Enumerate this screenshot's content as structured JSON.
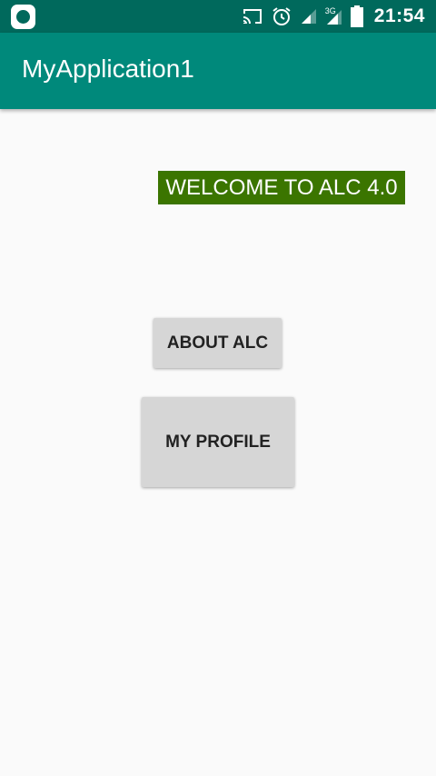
{
  "status_bar": {
    "time": "21:54",
    "network_label": "3G",
    "icons": [
      "app-notification-icon",
      "cast-icon",
      "alarm-icon",
      "signal-icon",
      "signal-3g-icon",
      "battery-icon"
    ]
  },
  "app_bar": {
    "title": "MyApplication1",
    "color": "#00897b"
  },
  "main": {
    "welcome_text": "WELCOME TO ALC 4.0",
    "welcome_bg": "#3b7500",
    "about_button_label": "ABOUT ALC",
    "profile_button_label": "MY PROFILE"
  }
}
